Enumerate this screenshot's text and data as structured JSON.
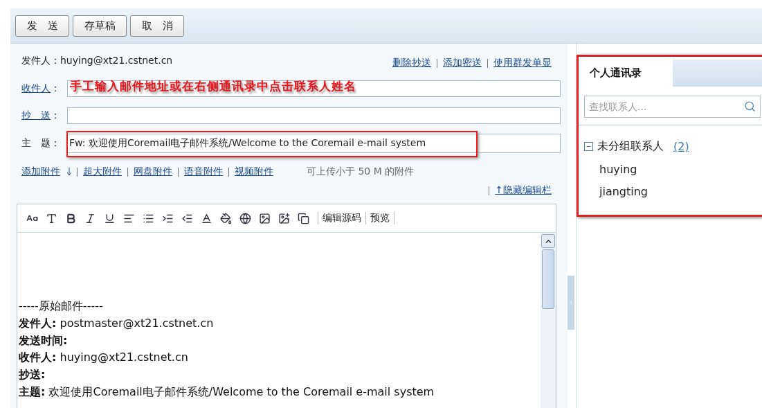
{
  "toolbar": {
    "buttons": [
      "发　送",
      "存草稿",
      "取　消"
    ]
  },
  "compose": {
    "sender": {
      "label": "发件人：",
      "value": "huying@xt21.cstnet.cn"
    },
    "sender_links": [
      "删除抄送",
      "添加密送",
      "使用群发单显"
    ],
    "fields": [
      {
        "label": "收件人",
        "colon": "：",
        "annotation": "手工输入邮件地址或在右侧通讯录中点击联系人姓名",
        "link": true,
        "highlighted": false
      },
      {
        "label": "抄　送",
        "colon": "：",
        "link": true,
        "highlighted": false
      },
      {
        "label": "主　题",
        "colon": "：",
        "value": "Fw: 欢迎使用Coremail电子邮件系统/Welcome to the Coremail e-mail system",
        "link": false,
        "highlighted": true
      }
    ],
    "attachment_links": [
      "添加附件",
      "超大附件",
      "网盘附件",
      "语音附件",
      "视频附件"
    ],
    "attachment_note": "可上传小于 50 M 的附件",
    "hide_editor_link": "↑隐藏编辑栏"
  },
  "editor": {
    "text_buttons": [
      "编辑源码",
      "预览"
    ],
    "body": [
      "-----原始邮件-----",
      "**发件人:** postmaster@xt21.cstnet.cn",
      "**发送时间:**",
      "**收件人:** huying@xt21.cstnet.cn",
      "**抄送:**",
      "**主题:** 欢迎使用Coremail电子邮件系统/Welcome to the Coremail e-mail system"
    ]
  },
  "contacts": {
    "tabs": [
      {
        "label": "个人通讯录",
        "selected": true
      }
    ],
    "search": {
      "placeholder": "查找联系人..."
    },
    "groups": [
      {
        "name": "未分组联系人",
        "count": "(2)",
        "expanded": true,
        "children": [
          {
            "name": "huying"
          },
          {
            "name": "jiangting"
          }
        ]
      }
    ]
  }
}
